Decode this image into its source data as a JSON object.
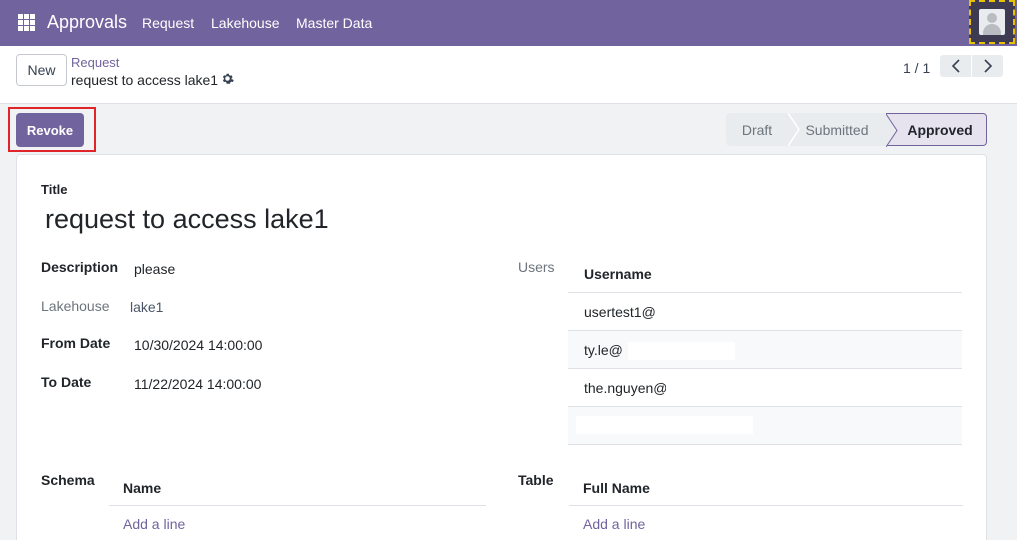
{
  "navbar": {
    "app_title": "Approvals",
    "menu": [
      "Request",
      "Lakehouse",
      "Master Data"
    ],
    "apps_icon": "grid-icon",
    "avatar_icon": "user-avatar-icon",
    "color": "#71639e"
  },
  "control_panel": {
    "new_label": "New",
    "breadcrumb": "Request",
    "record_name": "request to access lake1",
    "pager": "1 / 1"
  },
  "actions": {
    "revoke_label": "Revoke"
  },
  "status_bar": {
    "stages": [
      "Draft",
      "Submitted",
      "Approved"
    ],
    "current": "Approved"
  },
  "form": {
    "title_label": "Title",
    "title_value": "request to access lake1",
    "description_label": "Description",
    "description_value": "please",
    "lakehouse_label": "Lakehouse",
    "lakehouse_value": "lake1",
    "from_date_label": "From Date",
    "from_date_value": "10/30/2024 14:00:00",
    "to_date_label": "To Date",
    "to_date_value": "11/22/2024 14:00:00",
    "users_label": "Users",
    "users_table": {
      "header": "Username",
      "rows": [
        "usertest1@",
        "ty.le@",
        "the.nguyen@",
        ""
      ]
    },
    "schema_label": "Schema",
    "schema_table": {
      "header": "Name",
      "add_line": "Add a line"
    },
    "table_label": "Table",
    "table_table": {
      "header": "Full Name",
      "add_line": "Add a line"
    }
  }
}
